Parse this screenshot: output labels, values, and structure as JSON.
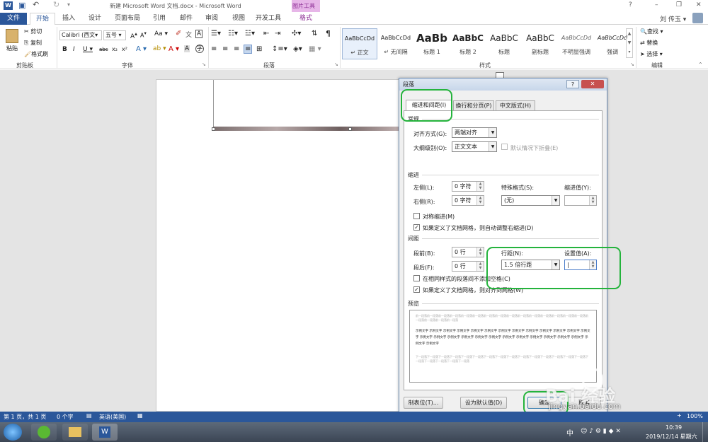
{
  "titlebar": {
    "title": "新建 Microsoft Word 文档.docx - Microsoft Word",
    "context_tab": "图片工具",
    "help": "?",
    "minimize": "–",
    "restore": "❐",
    "close": "✕"
  },
  "tabs": [
    {
      "label": "文件"
    },
    {
      "label": "开始"
    },
    {
      "label": "插入"
    },
    {
      "label": "设计"
    },
    {
      "label": "页面布局"
    },
    {
      "label": "引用"
    },
    {
      "label": "邮件"
    },
    {
      "label": "审阅"
    },
    {
      "label": "视图"
    },
    {
      "label": "开发工具"
    },
    {
      "label": "格式"
    }
  ],
  "user": {
    "name": "刘 传玉 ▾"
  },
  "ribbon": {
    "clipboard": {
      "paste": "粘贴",
      "cut": "剪切",
      "copy": "复制",
      "format_painter": "格式刷",
      "group": "剪贴板"
    },
    "font": {
      "name": "Calibri (西文▾",
      "size": "五号",
      "group": "字体"
    },
    "paragraph": {
      "group": "段落"
    },
    "styles": {
      "group": "样式",
      "items": [
        {
          "sample": "AaBbCcDd",
          "name": "↵ 正文"
        },
        {
          "sample": "AaBbCcDd",
          "name": "↵ 无间隔"
        },
        {
          "sample": "AaBb",
          "name": "标题 1"
        },
        {
          "sample": "AaBbC",
          "name": "标题 2"
        },
        {
          "sample": "AaBbC",
          "name": "标题"
        },
        {
          "sample": "AaBbC",
          "name": "副标题"
        },
        {
          "sample": "AaBbCcDd",
          "name": "不明显强调"
        },
        {
          "sample": "AaBbCcDd",
          "name": "强调"
        }
      ]
    },
    "editing": {
      "find": "查找 ▾",
      "replace": "替换",
      "select": "选择 ▾",
      "group": "编辑"
    }
  },
  "dialog": {
    "title": "段落",
    "help": "?",
    "close": "✕",
    "tabs": [
      {
        "label": "缩进和间距(I)"
      },
      {
        "label": "换行和分页(P)"
      },
      {
        "label": "中文版式(H)"
      }
    ],
    "general": {
      "title": "常规",
      "alignment_label": "对齐方式(G):",
      "alignment_value": "两端对齐",
      "outline_label": "大纲级别(O):",
      "outline_value": "正文文本",
      "collapse_label": "默认情况下折叠(E)"
    },
    "indent": {
      "title": "缩进",
      "left_label": "左侧(L):",
      "left_value": "0 字符",
      "right_label": "右侧(R):",
      "right_value": "0 字符",
      "special_label": "特殊格式(S):",
      "special_value": "(无)",
      "by_label": "缩进值(Y):",
      "by_value": "",
      "mirror_label": "对称缩进(M)",
      "auto_adjust_label": "如果定义了文档网格，则自动调整右缩进(D)"
    },
    "spacing": {
      "title": "间距",
      "before_label": "段前(B):",
      "before_value": "0 行",
      "after_label": "段后(F):",
      "after_value": "0 行",
      "line_label": "行距(N):",
      "line_value": "1.5 倍行距",
      "at_label": "设置值(A):",
      "at_value": "|",
      "no_space_label": "在相同样式的段落间不添加空格(C)",
      "snap_label": "如果定义了文档网格，则对齐到网格(W)"
    },
    "preview": {
      "title": "预览",
      "prev_text": "前一段落前一段落前一段落前一段落前一段落前一段落前一段落前一段落前一段落前一段落前一段落前一段落前一段落前一段落前一段落前一段落前一段落前一段落前一段落",
      "sample_text": "示例文字 示例文字 示例文字 示例文字 示例文字 示例文字 示例文字 示例文字 示例文字 示例文字 示例文字 示例文字 示例文字 示例文字 示例文字 示例文字 示例文字 示例文字 示例文字 示例文字 示例文字 示例文字 示例文字 示例文字 示例文字 示例文字 示例文字",
      "next_text": "下一段落下一段落下一段落下一段落下一段落下一段落下一段落下一段落下一段落下一段落下一段落下一段落下一段落下一段落下一段落下一段落下一段落下一段落下一段落下一段落"
    },
    "buttons": {
      "tabs": "制表位(T)...",
      "set_default": "设为默认值(D)",
      "ok": "确定",
      "cancel": "取消"
    }
  },
  "statusbar": {
    "page": "第 1 页，共 1 页",
    "words": "0 个字",
    "lang": "英语(美国)",
    "zoom": "100%"
  },
  "taskbar": {
    "time": "10:39",
    "date": "2019/12/14 星期六",
    "ime": "中"
  },
  "watermark": {
    "brand": "Bai  经验",
    "url": "jingyan.baidu.com"
  }
}
